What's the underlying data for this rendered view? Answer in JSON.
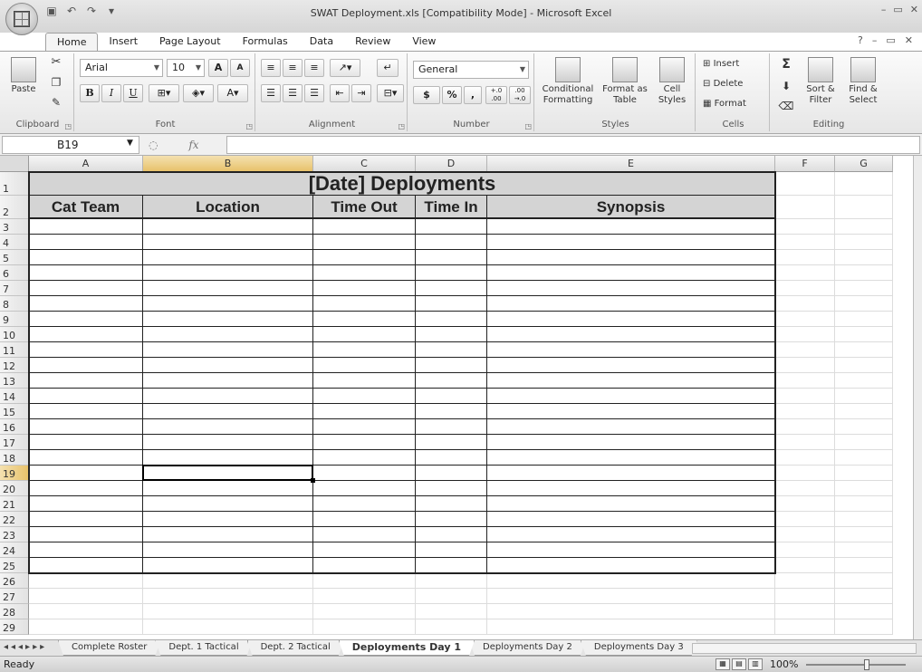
{
  "window": {
    "title": "SWAT Deployment.xls  [Compatibility Mode] - Microsoft Excel",
    "controls": [
      "–",
      "▭",
      "✕"
    ]
  },
  "ribbon": {
    "tabs": [
      "Home",
      "Insert",
      "Page Layout",
      "Formulas",
      "Data",
      "Review",
      "View"
    ],
    "active_tab": "Home",
    "help_controls": [
      "?",
      "–",
      "▭",
      "✕"
    ],
    "clipboard": {
      "label": "Clipboard",
      "paste": "Paste"
    },
    "font": {
      "label": "Font",
      "name": "Arial",
      "size": "10",
      "bold": "B",
      "italic": "I",
      "underline": "U",
      "grow": "A",
      "shrink": "A"
    },
    "alignment": {
      "label": "Alignment"
    },
    "number": {
      "label": "Number",
      "format": "General",
      "currency": "$",
      "percent": "%",
      "comma": ",",
      "inc_decimal": "+.0 .00",
      "dec_decimal": ".00 →.0"
    },
    "styles": {
      "label": "Styles",
      "conditional": "Conditional Formatting",
      "format_table": "Format as Table",
      "cell_styles": "Cell Styles"
    },
    "cells": {
      "label": "Cells",
      "insert": "Insert",
      "delete": "Delete",
      "format": "Format"
    },
    "editing": {
      "label": "Editing",
      "sum": "Σ",
      "sort_filter": "Sort & Filter",
      "find_select": "Find & Select"
    }
  },
  "formula_bar": {
    "name_box": "B19",
    "fx": "fx",
    "content": ""
  },
  "columns": [
    "A",
    "B",
    "C",
    "D",
    "E",
    "F",
    "G"
  ],
  "rows": [
    "1",
    "2",
    "3",
    "4",
    "5",
    "6",
    "7",
    "8",
    "9",
    "10",
    "11",
    "12",
    "13",
    "14",
    "15",
    "16",
    "17",
    "18",
    "19",
    "20",
    "21",
    "22",
    "23",
    "24",
    "25",
    "26",
    "27",
    "28",
    "29"
  ],
  "selected_cell": {
    "column": "B",
    "row": "19"
  },
  "sheet": {
    "title": "[Date] Deployments",
    "headers": [
      "Cat Team",
      "Location",
      "Time Out",
      "Time In",
      "Synopsis"
    ]
  },
  "sheet_tabs": [
    "Complete Roster",
    "Dept. 1 Tactical",
    "Dept. 2 Tactical",
    "Deployments Day 1",
    "Deployments Day 2",
    "Deployments Day 3"
  ],
  "active_sheet": "Deployments Day 1",
  "status": {
    "text": "Ready",
    "zoom": "100%"
  }
}
